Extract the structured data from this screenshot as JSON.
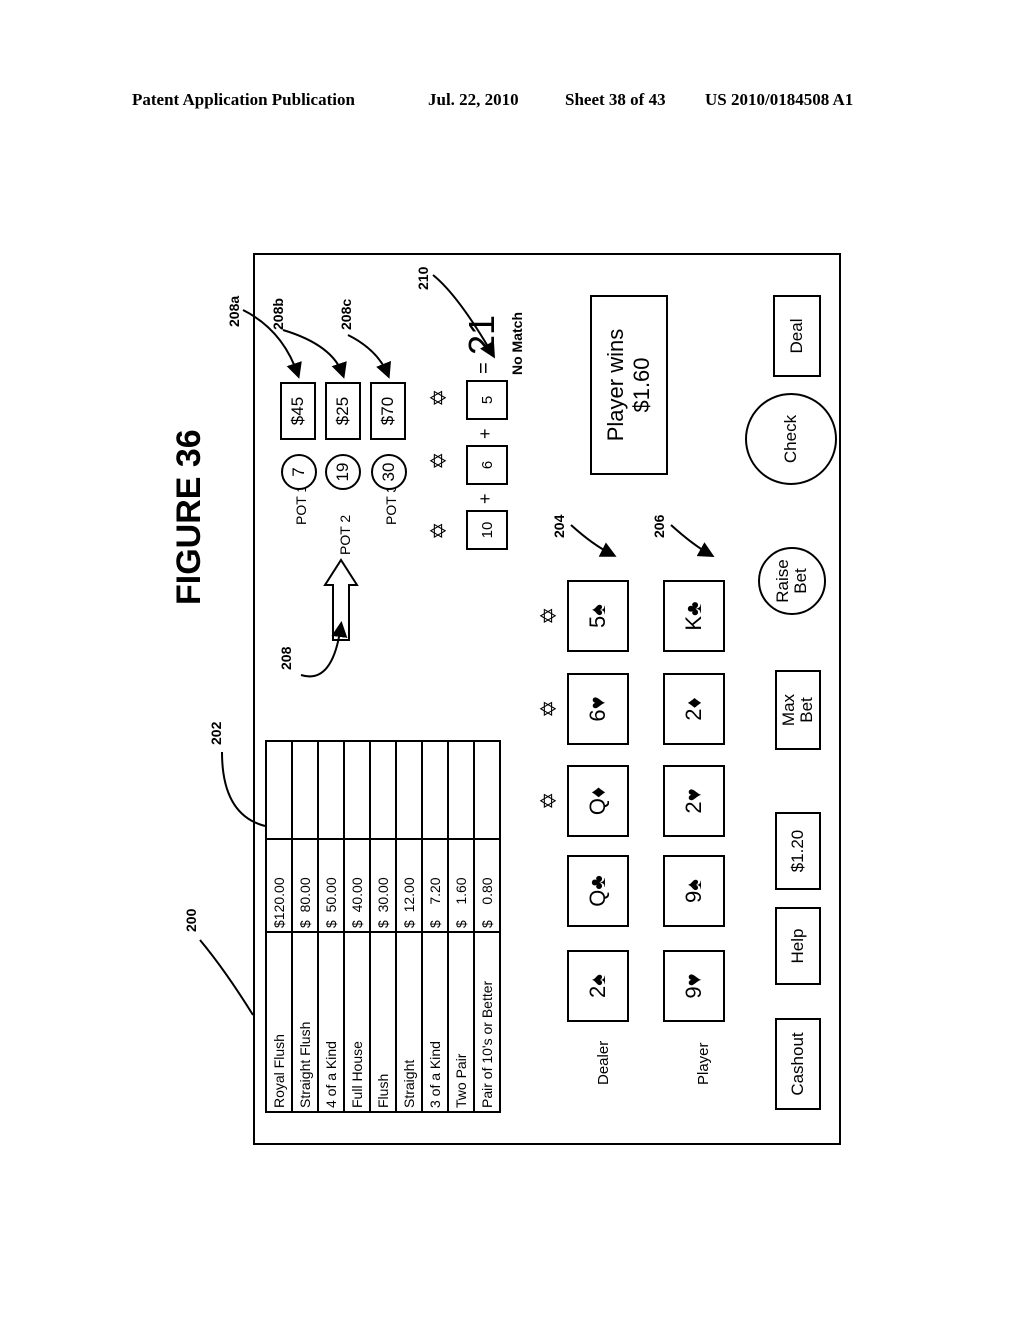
{
  "header": {
    "publication": "Patent Application Publication",
    "date": "Jul. 22, 2010",
    "sheet": "Sheet 38 of 43",
    "number": "US 2010/0184508 A1"
  },
  "figure_title": "FIGURE 36",
  "ref_labels": {
    "r200": "200",
    "r202": "202",
    "r204": "204",
    "r206": "206",
    "r208": "208",
    "r208a": "208a",
    "r208b": "208b",
    "r208c": "208c",
    "r210": "210"
  },
  "paytable": [
    {
      "hand": "Royal Flush",
      "payout": "$120.00"
    },
    {
      "hand": "Straight Flush",
      "payout": "$  80.00"
    },
    {
      "hand": "4 of a Kind",
      "payout": "$  50.00"
    },
    {
      "hand": "Full House",
      "payout": "$  40.00"
    },
    {
      "hand": "Flush",
      "payout": "$  30.00"
    },
    {
      "hand": "Straight",
      "payout": "$  12.00"
    },
    {
      "hand": "3 of a Kind",
      "payout": "$    7.20"
    },
    {
      "hand": "Two Pair",
      "payout": "$    1.60"
    },
    {
      "hand": "Pair of 10's or Better",
      "payout": "$    0.80"
    }
  ],
  "dealer": {
    "label": "Dealer",
    "cards": [
      "2♠",
      "Q♣",
      "Q♦",
      "6♥",
      "5♠"
    ],
    "starred": [
      false,
      false,
      true,
      true,
      true
    ]
  },
  "player": {
    "label": "Player",
    "cards": [
      "9♥",
      "9♠",
      "2♥",
      "2♦",
      "K♣"
    ]
  },
  "pots": [
    {
      "label": "POT 1",
      "number": "7",
      "amount": "$45"
    },
    {
      "label": "POT 2",
      "number": "19",
      "amount": "$25"
    },
    {
      "label": "POT 3",
      "number": "30",
      "amount": "$70"
    }
  ],
  "sum": {
    "values": [
      "10",
      "6",
      "5"
    ],
    "plus": "+",
    "equals": "=",
    "total": "21",
    "result": "No Match"
  },
  "message": {
    "line1": "Player wins",
    "line2": "$1.60"
  },
  "buttons": {
    "cashout": "Cashout",
    "help": "Help",
    "bet_amount": "$1.20",
    "max_bet_1": "Max",
    "max_bet_2": "Bet",
    "raise_bet_1": "Raise",
    "raise_bet_2": "Bet",
    "check": "Check",
    "deal": "Deal"
  }
}
